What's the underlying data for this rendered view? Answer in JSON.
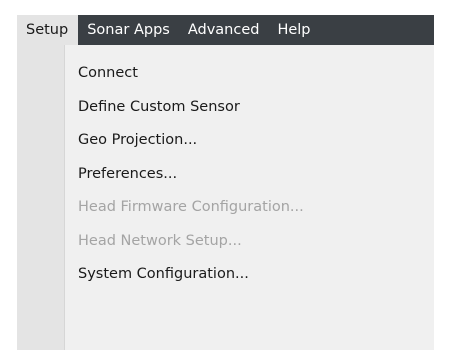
{
  "menubar": {
    "items": [
      {
        "label": "Setup",
        "active": true
      },
      {
        "label": "Sonar Apps",
        "active": false
      },
      {
        "label": "Advanced",
        "active": false
      },
      {
        "label": "Help",
        "active": false
      }
    ]
  },
  "setup_menu": {
    "items": [
      {
        "label": "Connect",
        "enabled": true
      },
      {
        "label": "Define Custom Sensor",
        "enabled": true
      },
      {
        "label": "Geo Projection...",
        "enabled": true
      },
      {
        "label": "Preferences...",
        "enabled": true
      },
      {
        "label": "Head Firmware Configuration...",
        "enabled": false
      },
      {
        "label": "Head Network Setup...",
        "enabled": false
      },
      {
        "label": "System Configuration...",
        "enabled": true
      }
    ]
  },
  "colors": {
    "menubar_bg": "#3a3f44",
    "menubar_text": "#ffffff",
    "active_bg": "#e4e4e4",
    "panel_bg": "#f0f0f0",
    "disabled_text": "#a4a4a4"
  }
}
